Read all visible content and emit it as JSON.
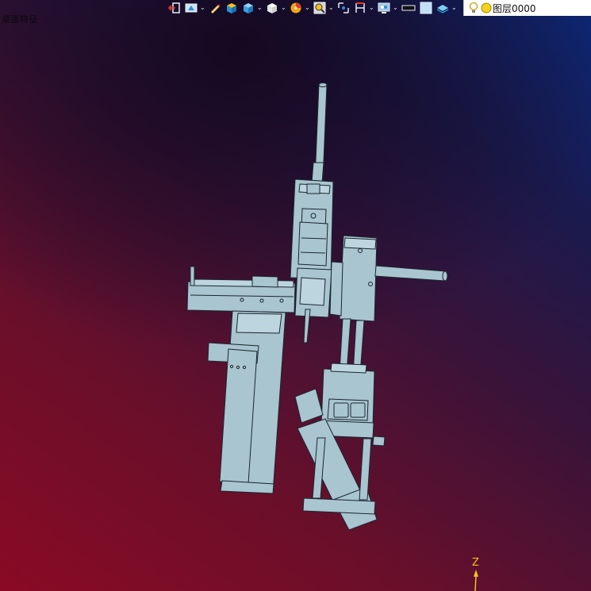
{
  "window": {
    "model_title": "桌面特征"
  },
  "toolbar": {
    "items": [
      {
        "icon": "exit-sketch-icon",
        "has_menu": false
      },
      {
        "icon": "view-orientation-icon",
        "has_menu": true
      },
      {
        "icon": "measure-pen-icon",
        "has_menu": false
      },
      {
        "icon": "shaded-box-icon",
        "has_menu": false
      },
      {
        "icon": "render-style-icon",
        "has_menu": true
      },
      {
        "icon": "standard-view-icon",
        "has_menu": true
      },
      {
        "icon": "sketch-display-icon",
        "has_menu": true
      },
      {
        "icon": "zoom-icon",
        "has_menu": true
      },
      {
        "icon": "snap-icon",
        "has_menu": false
      },
      {
        "icon": "section-icon",
        "has_menu": true
      },
      {
        "icon": "display-settings-icon",
        "has_menu": true
      },
      {
        "icon": "line-style-icon",
        "has_menu": false
      },
      {
        "icon": "color-swatch-icon",
        "has_menu": false
      },
      {
        "icon": "layer-visibility-icon",
        "has_menu": true
      }
    ],
    "layer_label": "图层0000",
    "colors": {
      "icon_light": "#e8ecf6",
      "accent_blue": "#2b8fd6",
      "accent_yellow": "#f4c21a",
      "accent_red": "#e2352b"
    }
  },
  "viewport": {
    "axis_label": "Z",
    "background": {
      "top_right": "#0b2a7e",
      "bottom_left": "#8a0a24",
      "top_left": "#14081e"
    },
    "model_fill": "#a9c5cf",
    "model_edge": "#1a2630"
  }
}
